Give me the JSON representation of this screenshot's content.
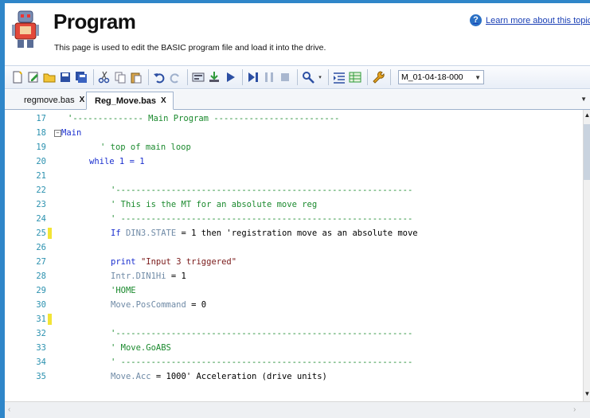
{
  "header": {
    "title": "Program",
    "description": "This page is used to edit the BASIC program file  and load it into the drive.",
    "help_link": "Learn more about this topic",
    "help_icon": "?"
  },
  "toolbar": {
    "firmware_value": "M_01-04-18-000"
  },
  "tabs": [
    {
      "label": "regmove.bas",
      "close": "X",
      "active": false
    },
    {
      "label": "Reg_Move.bas",
      "close": "X",
      "active": true
    }
  ],
  "code_lines": [
    {
      "num": "17",
      "text": "'-------------- Main Program -------------------------"
    },
    {
      "num": "18",
      "text": "Main"
    },
    {
      "num": "19",
      "text": "' top of main loop"
    },
    {
      "num": "20",
      "text": "while 1 = 1"
    },
    {
      "num": "21",
      "text": ""
    },
    {
      "num": "22",
      "text": "'-----------------------------------------------------------"
    },
    {
      "num": "23",
      "text": "' This is the MT for an absolute move reg"
    },
    {
      "num": "24",
      "text": "' ----------------------------------------------------------"
    },
    {
      "num": "25",
      "p1": "If ",
      "p2": "DIN3.STATE",
      "p3": " = 1 then 'registration move as an absolute move"
    },
    {
      "num": "26",
      "text": ""
    },
    {
      "num": "27",
      "p1": "print ",
      "p2": "\"Input 3 triggered\""
    },
    {
      "num": "28",
      "p1": "Intr.DIN1Hi",
      "p2": " = 1"
    },
    {
      "num": "29",
      "text": "'HOME"
    },
    {
      "num": "30",
      "p1": "Move.PosCommand",
      "p2": " = 0"
    },
    {
      "num": "31",
      "text": ""
    },
    {
      "num": "32",
      "text": "'-----------------------------------------------------------"
    },
    {
      "num": "33",
      "text": "' Move.GoABS"
    },
    {
      "num": "34",
      "text": "' ----------------------------------------------------------"
    },
    {
      "num": "35",
      "p1": "Move.Acc",
      "p2": " = 1000",
      "p3": "' Acceleration (drive units)"
    }
  ]
}
